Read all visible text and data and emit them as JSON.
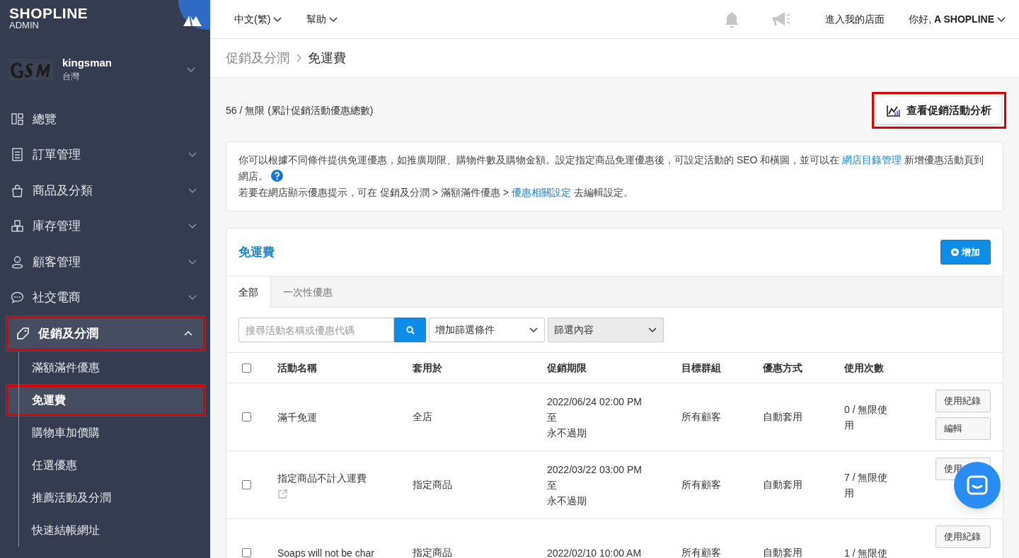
{
  "brand": {
    "name": "SHOPLINE",
    "sub": "ADMIN"
  },
  "store": {
    "name": "kingsman",
    "region": "台灣"
  },
  "sidebar": {
    "items": [
      {
        "label": "總覽",
        "kind": "link",
        "selected": false,
        "highlighted": false
      },
      {
        "label": "訂單管理",
        "kind": "group",
        "expanded": false,
        "selected": false,
        "highlighted": false
      },
      {
        "label": "商品及分類",
        "kind": "group",
        "expanded": false,
        "selected": false,
        "highlighted": false
      },
      {
        "label": "庫存管理",
        "kind": "group",
        "expanded": false,
        "selected": false,
        "highlighted": false
      },
      {
        "label": "顧客管理",
        "kind": "group",
        "expanded": false,
        "selected": false,
        "highlighted": false
      },
      {
        "label": "社交電商",
        "kind": "group",
        "expanded": false,
        "selected": false,
        "highlighted": false
      },
      {
        "label": "促銷及分潤",
        "kind": "group",
        "expanded": true,
        "selected": true,
        "highlighted": true,
        "children": [
          {
            "label": "滿額滿件優惠",
            "selected": false,
            "highlighted": false
          },
          {
            "label": "免運費",
            "selected": true,
            "highlighted": true
          },
          {
            "label": "購物車加價購",
            "selected": false,
            "highlighted": false
          },
          {
            "label": "任選優惠",
            "selected": false,
            "highlighted": false
          },
          {
            "label": "推薦活動及分潤",
            "selected": false,
            "highlighted": false
          },
          {
            "label": "快速結帳網址",
            "selected": false,
            "highlighted": false
          }
        ]
      }
    ]
  },
  "topbar": {
    "menus": [
      {
        "label": "中文(繁)"
      },
      {
        "label": "幫助"
      }
    ],
    "storefront_link": "進入我的店面",
    "user": "你好, **A SHOPLINE**"
  },
  "breadcrumb": [
    {
      "label": "促銷及分潤",
      "current": false
    },
    {
      "label": "免運費",
      "current": true
    }
  ],
  "quota": "56 / 無限 (累計促銷活動優惠總數)",
  "analytics_button": {
    "label": "查看促銷活動分析",
    "highlighted": true
  },
  "info": {
    "paragraphs": [
      [
        {
          "text": "你可以根據不同條件提供免運優惠，如推廣期限、購物件數及購物金額。設定指定商品免運優惠後，可設定活動的 SEO 和橫圖，並可以在 "
        },
        {
          "link": "網店目錄管理"
        },
        {
          "text": " 新增優惠活動頁到網店。"
        },
        {
          "help": true
        }
      ],
      [
        {
          "text": "若要在網店顯示優惠提示，可在 促銷及分潤 > 滿額滿件優惠 > "
        },
        {
          "link": "優惠相關設定"
        },
        {
          "text": " 去編輯設定。"
        }
      ]
    ]
  },
  "card": {
    "title": "免運費",
    "add_button": "增加",
    "tabs": [
      {
        "label": "全部",
        "selected": true
      },
      {
        "label": "一次性優惠",
        "selected": false
      }
    ],
    "search": {
      "placeholder": "搜尋活動名稱或優惠代碼"
    },
    "filters": [
      {
        "label": "增加篩選條件",
        "disabled": false
      },
      {
        "label": "篩選內容",
        "disabled": true
      }
    ],
    "table": {
      "header_checked": false,
      "columns": [
        "活動名稱",
        "套用於",
        "促銷期限",
        "目標群組",
        "優惠方式",
        "使用次數"
      ],
      "rows": [
        {
          "checked": false,
          "name": "滿千免運",
          "external_link": false,
          "applies_to": "全店",
          "period": [
            "2022/06/24 02:00 PM",
            "至",
            "永不過期"
          ],
          "audience": "所有顧客",
          "method": "自動套用",
          "usage": "0 / 無限使用",
          "actions": [
            "使用紀錄",
            "編輯"
          ]
        },
        {
          "checked": false,
          "name": "指定商品不計入運費",
          "external_link": true,
          "applies_to": "指定商品",
          "period": [
            "2022/03/22 03:00 PM",
            "至",
            "永不過期"
          ],
          "audience": "所有顧客",
          "method": "自動套用",
          "usage": "7 / 無限使用",
          "actions": [
            "使用"
          ]
        },
        {
          "checked": false,
          "name": "Soaps will not be char",
          "external_link": false,
          "applies_to": "指定商品",
          "period": [
            "2022/02/10 10:00 AM"
          ],
          "audience": "所有顧客",
          "method": "自動套用",
          "usage": "1 / 無限使",
          "actions": [
            "使用紀錄"
          ]
        }
      ]
    }
  }
}
